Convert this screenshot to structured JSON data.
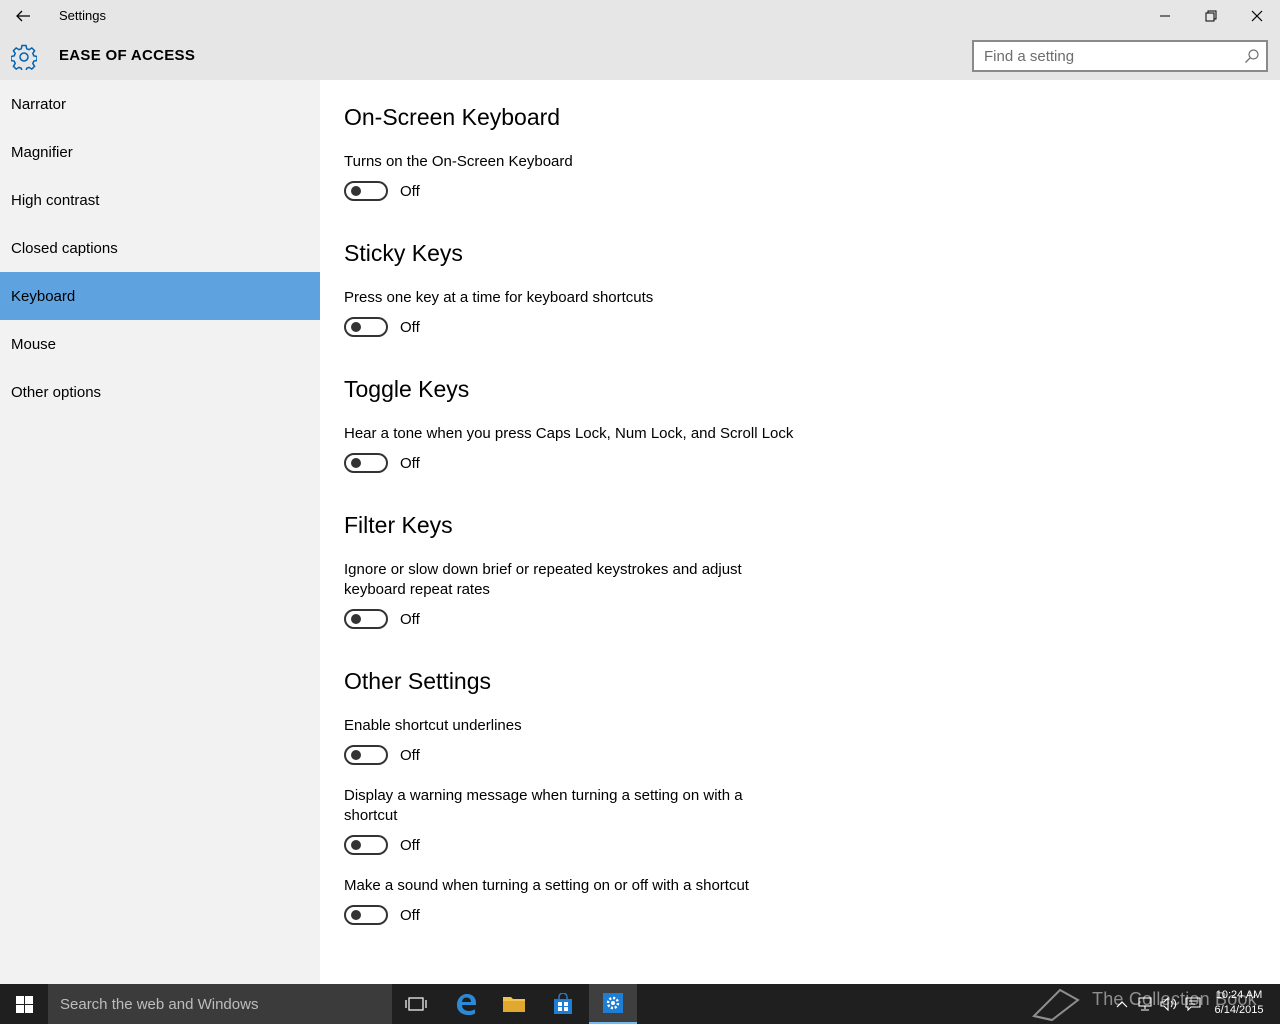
{
  "window": {
    "title": "Settings"
  },
  "header": {
    "section_title": "EASE OF ACCESS",
    "search_placeholder": "Find a setting"
  },
  "sidebar": {
    "items": [
      {
        "label": "Narrator"
      },
      {
        "label": "Magnifier"
      },
      {
        "label": "High contrast"
      },
      {
        "label": "Closed captions"
      },
      {
        "label": "Keyboard",
        "selected": true
      },
      {
        "label": "Mouse"
      },
      {
        "label": "Other options"
      }
    ]
  },
  "main": {
    "sections": [
      {
        "title": "On-Screen Keyboard",
        "settings": [
          {
            "description": "Turns on the On-Screen Keyboard",
            "state": "Off"
          }
        ]
      },
      {
        "title": "Sticky Keys",
        "settings": [
          {
            "description": "Press one key at a time for keyboard shortcuts",
            "state": "Off"
          }
        ]
      },
      {
        "title": "Toggle Keys",
        "settings": [
          {
            "description": "Hear a tone when you press Caps Lock, Num Lock, and Scroll Lock",
            "state": "Off"
          }
        ]
      },
      {
        "title": "Filter Keys",
        "settings": [
          {
            "description": "Ignore or slow down brief or repeated keystrokes and adjust keyboard repeat rates",
            "state": "Off"
          }
        ]
      },
      {
        "title": "Other Settings",
        "settings": [
          {
            "description": "Enable shortcut underlines",
            "state": "Off"
          },
          {
            "description": "Display a warning message when turning a setting on with a shortcut",
            "state": "Off"
          },
          {
            "description": "Make a sound when turning a setting on or off with a shortcut",
            "state": "Off"
          }
        ]
      }
    ]
  },
  "taskbar": {
    "search_placeholder": "Search the web and Windows",
    "watermark": "The Collection Book",
    "clock": {
      "time": "10:24 AM",
      "date": "6/14/2015"
    }
  },
  "colors": {
    "accent": "#5ea3e0",
    "chrome": "#e6e6e6",
    "sidebar_bg": "#f2f2f2",
    "taskbar_bg": "#1f1f1f"
  }
}
